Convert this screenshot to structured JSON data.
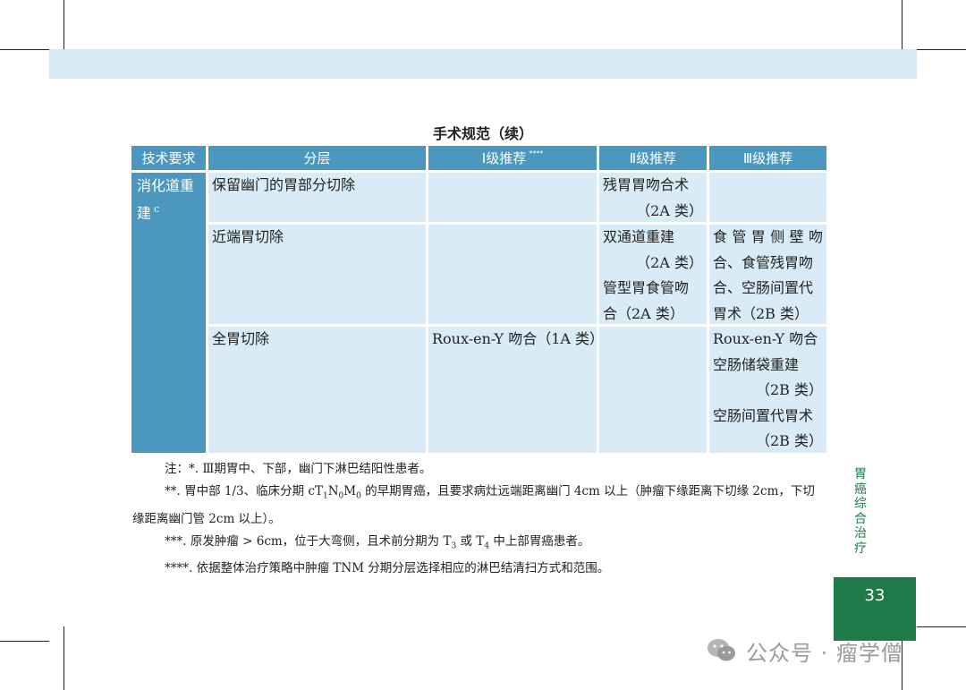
{
  "page": {
    "table_title": "手术规范（续）",
    "page_number": "33",
    "side_label": "胃癌综合治疗",
    "watermark": "公众号 · 瘤学僧"
  },
  "table": {
    "headers": {
      "col1": "技术要求",
      "col2": "分层",
      "col3": "Ⅰ级推荐",
      "col3_sup": "****",
      "col4": "Ⅱ级推荐",
      "col5": "Ⅲ级推荐"
    },
    "row_head": {
      "line1": "消化道重",
      "line2": "建",
      "sup": "c"
    },
    "rows": [
      {
        "stratum": "保留幽门的胃部分切除",
        "level1": "",
        "level2": [
          "残胃胃吻合术",
          "（2A 类）"
        ],
        "level3": []
      },
      {
        "stratum": "近端胃切除",
        "level1": "",
        "level2": [
          "双通道重建",
          "（2A 类）",
          "管型胃食管吻",
          "合（2A 类）"
        ],
        "level3": [
          "食管胃侧壁吻",
          "合、食管残胃吻",
          "合、空肠间置代",
          "胃术（2B 类）"
        ]
      },
      {
        "stratum": "全胃切除",
        "level1": "Roux-en-Y 吻合（1A 类）",
        "level2": [],
        "level3": [
          "Roux-en-Y 吻合",
          "空肠储袋重建",
          "（2B 类）",
          "空肠间置代胃术",
          "（2B 类）"
        ]
      }
    ]
  },
  "notes": {
    "n1": "注：*. Ⅲ期胃中、下部，幽门下淋巴结阳性患者。",
    "n2_a": "**. 胃中部 1/3、临床分期 cT",
    "n2_sub1": "1",
    "n2_b": "N",
    "n2_sub2": "0",
    "n2_c": "M",
    "n2_sub3": "0",
    "n2_d": " 的早期胃癌，且要求病灶远端距离幽门 4cm 以上（肿瘤下缘距离下切缘 2cm，下切缘距离幽门管 2cm 以上）。",
    "n3_a": "***. 原发肿瘤 > 6cm，位于大弯侧，且术前分期为 T",
    "n3_sub1": "3",
    "n3_b": " 或 T",
    "n3_sub2": "4",
    "n3_c": " 中上部胃癌患者。",
    "n4": "****. 依据整体治疗策略中肿瘤 TNM 分期分层选择相应的淋巴结清扫方式和范围。"
  },
  "colors": {
    "header_blue": "#4b97bd",
    "cell_light_blue": "#d9ebf7",
    "green_accent": "#1f7a4a"
  }
}
